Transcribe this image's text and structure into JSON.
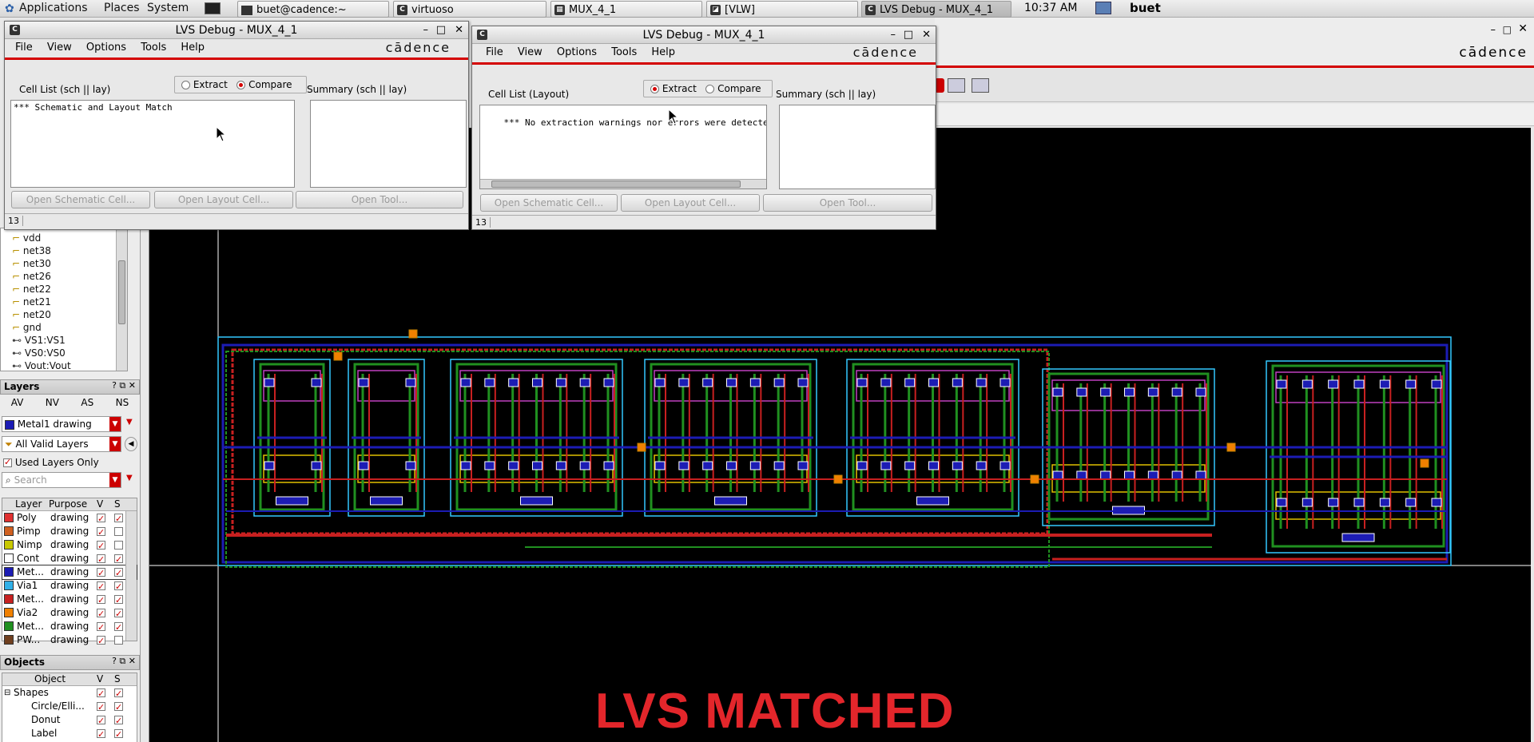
{
  "panel": {
    "menus": [
      "Applications",
      "Places",
      "System"
    ],
    "tasks": [
      {
        "label": "buet@cadence:~"
      },
      {
        "label": "virtuoso"
      },
      {
        "label": "MUX_4_1"
      },
      {
        "label": "[VLW]"
      },
      {
        "label": "LVS Debug - MUX_4_1"
      }
    ],
    "clock": "10:37 AM",
    "user": "buet"
  },
  "main_window": {
    "cadence_logo": "cādence",
    "nav_items": [
      "vdd",
      "net38",
      "net30",
      "net26",
      "net22",
      "net21",
      "net20",
      "gnd",
      "VS1:VS1",
      "VS0:VS0",
      "Vout:Vout"
    ],
    "layers_panel": {
      "title": "Layers",
      "tabs": [
        "AV",
        "NV",
        "AS",
        "NS"
      ],
      "current_layer": "Metal1 drawing",
      "filter": "All Valid Layers",
      "used_only_label": "Used Layers Only",
      "search_placeholder": "Search",
      "columns": [
        "Layer",
        "Purpose",
        "V",
        "S"
      ],
      "rows": [
        {
          "layer": "Poly",
          "purpose": "drawing",
          "color": "#e03030",
          "v": true,
          "s": true
        },
        {
          "layer": "Pimp",
          "purpose": "drawing",
          "color": "#d06020",
          "v": true,
          "s": false
        },
        {
          "layer": "Nimp",
          "purpose": "drawing",
          "color": "#c8c800",
          "v": true,
          "s": false
        },
        {
          "layer": "Cont",
          "purpose": "drawing",
          "color": "#ffffff",
          "v": true,
          "s": true
        },
        {
          "layer": "Met...",
          "purpose": "drawing",
          "color": "#1c1cb4",
          "v": true,
          "s": true
        },
        {
          "layer": "Via1",
          "purpose": "drawing",
          "color": "#30b0e8",
          "v": true,
          "s": true
        },
        {
          "layer": "Met...",
          "purpose": "drawing",
          "color": "#c82020",
          "v": true,
          "s": true
        },
        {
          "layer": "Via2",
          "purpose": "drawing",
          "color": "#f08000",
          "v": true,
          "s": true
        },
        {
          "layer": "Met...",
          "purpose": "drawing",
          "color": "#209020",
          "v": true,
          "s": true
        },
        {
          "layer": "PW...",
          "purpose": "drawing",
          "color": "#704020",
          "v": true,
          "s": false
        }
      ]
    },
    "objects_panel": {
      "title": "Objects",
      "columns": [
        "Object",
        "V",
        "S"
      ],
      "rows": [
        {
          "name": "Shapes",
          "v": true,
          "s": true
        },
        {
          "name": "Circle/Elli...",
          "v": true,
          "s": true
        },
        {
          "name": "Donut",
          "v": true,
          "s": true
        },
        {
          "name": "Label",
          "v": true,
          "s": true
        }
      ]
    },
    "banner": "LVS MATCHED"
  },
  "dialog_compare": {
    "title": "LVS Debug - MUX_4_1",
    "menu": [
      "File",
      "View",
      "Options",
      "Tools",
      "Help"
    ],
    "logo": "cādence",
    "mode_extract": "Extract",
    "mode_compare": "Compare",
    "selected_mode": "compare",
    "cell_list_label": "Cell List (sch || lay)",
    "summary_label": "Summary (sch || lay)",
    "cell_list_text": "*** Schematic and Layout Match",
    "buttons": [
      "Open Schematic Cell...",
      "Open Layout Cell...",
      "Open Tool..."
    ],
    "status": "13"
  },
  "dialog_extract": {
    "title": "LVS Debug - MUX_4_1",
    "menu": [
      "File",
      "View",
      "Options",
      "Tools",
      "Help"
    ],
    "logo": "cādence",
    "mode_extract": "Extract",
    "mode_compare": "Compare",
    "selected_mode": "extract",
    "cell_list_label": "Cell List (Layout)",
    "summary_label": "Summary (sch || lay)",
    "cell_list_text": "*** No extraction warnings nor errors were detecte",
    "buttons": [
      "Open Schematic Cell...",
      "Open Layout Cell...",
      "Open Tool..."
    ],
    "status": "13"
  }
}
